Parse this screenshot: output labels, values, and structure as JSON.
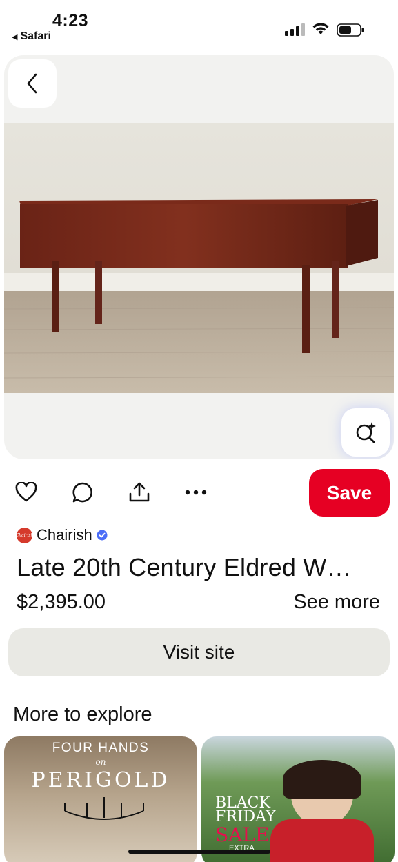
{
  "status_bar": {
    "time": "4:23",
    "back_app": "Safari",
    "back_indicator": "◀"
  },
  "pin": {
    "merchant": "Chairish",
    "merchant_logo_text": "Chairish",
    "title": "Late 20th Century Eldred W…",
    "price": "$2,395.00",
    "see_more": "See more",
    "save_label": "Save",
    "visit_label": "Visit site"
  },
  "explore": {
    "heading": "More to explore",
    "tiles": [
      {
        "line1": "FOUR HANDS",
        "line2": "on",
        "line3": "PERIGOLD"
      },
      {
        "line1": "BLACK",
        "line2": "FRIDAY",
        "line3": "SALE",
        "line4": "EXTRA"
      }
    ]
  },
  "colors": {
    "save_red": "#e60023",
    "visit_gray": "#e9e9e4",
    "verified_blue": "#4a6cf7"
  },
  "icons": [
    "back-chevron-icon",
    "visual-search-icon",
    "heart-icon",
    "comment-icon",
    "share-icon",
    "more-icon",
    "verified-icon"
  ]
}
